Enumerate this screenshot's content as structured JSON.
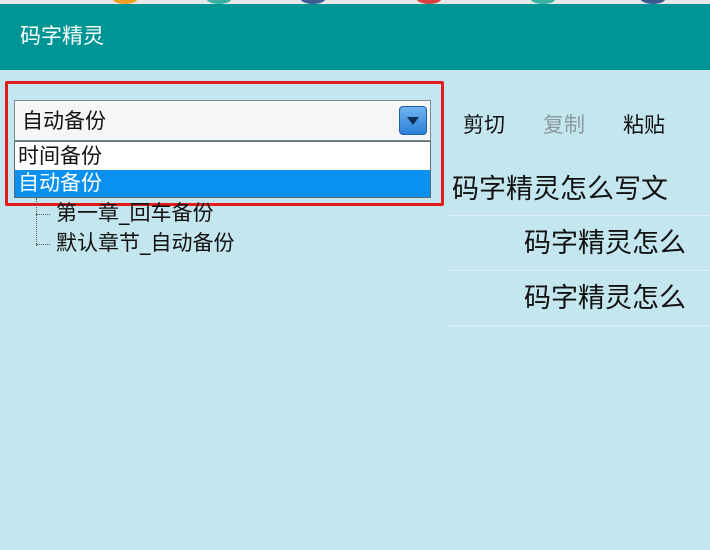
{
  "window": {
    "title": "码字精灵"
  },
  "backup_mode": {
    "selected": "自动备份",
    "options": [
      "时间备份",
      "自动备份"
    ],
    "highlighted_option": "自动备份"
  },
  "tree": {
    "items": [
      "第一章_回车备份",
      "默认章节_自动备份"
    ]
  },
  "toolbar": {
    "cut_label": "剪切",
    "copy_label": "复制",
    "paste_label": "粘贴"
  },
  "document": {
    "lines": [
      "码字精灵怎么写文",
      "码字精灵怎么",
      "码字精灵怎么"
    ]
  },
  "colors": {
    "title_bar": "#009595",
    "background": "#c4e6ee",
    "selection": "#0a90f0",
    "highlight_border": "#e51b1b"
  }
}
